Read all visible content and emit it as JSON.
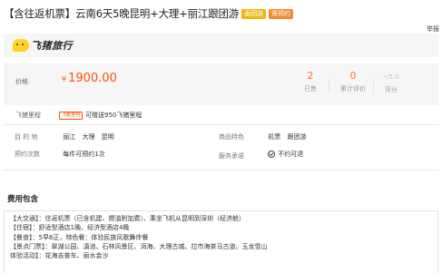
{
  "product": {
    "title": "【含往返机票】云南6天5晚昆明+大理+丽江跟团游",
    "badges": [
      "画团游",
      "需预约"
    ]
  },
  "report_label": "举报",
  "brand": {
    "name": "飞猪旅行"
  },
  "price": {
    "label": "价格",
    "currency": "¥",
    "value": "1900.00",
    "sold": {
      "value": "2",
      "label": "已售"
    },
    "reviews": {
      "value": "0",
      "label": "累计评价"
    },
    "score": {
      "value": "-",
      "suffix": "/5.0",
      "label": "评分"
    }
  },
  "miles": {
    "label": "飞猪里程",
    "tag": "飞猪里程",
    "text": "可赠送950飞猪里程"
  },
  "info": {
    "destination_label": "目 的 地",
    "destinations": [
      "丽江",
      "大理",
      "昆明"
    ],
    "features_label": "商品特色",
    "features": [
      "机票",
      "跟团游"
    ],
    "booking_label": "预约次数",
    "booking_value": "每件可预约1次",
    "service_label": "服务承诺",
    "service_value": "不约可退"
  },
  "fees": {
    "title": "费用包含",
    "lines": [
      "【大交通】：往返机票（已含机建、燃油附加费）、乘坐飞机从昆明到深圳（经济舱）",
      "【住宿】：舒适型酒店1晚、经济型酒店4晚",
      "【餐食】：5早6正，特色餐：体验民族风歌舞伴餐",
      "【景点门票】：翠湖公园、滇池、石林风景区、洱海、大理古城、拉市海茶马古道、玉龙雪山",
      "体验活动】：花海吉普车、丽水金沙"
    ]
  },
  "colors": {
    "price": "#ff5000",
    "badge_gold": "#f0b515",
    "badge_orange": "#f38a2d",
    "brand_yellow": "#ffd21f"
  }
}
